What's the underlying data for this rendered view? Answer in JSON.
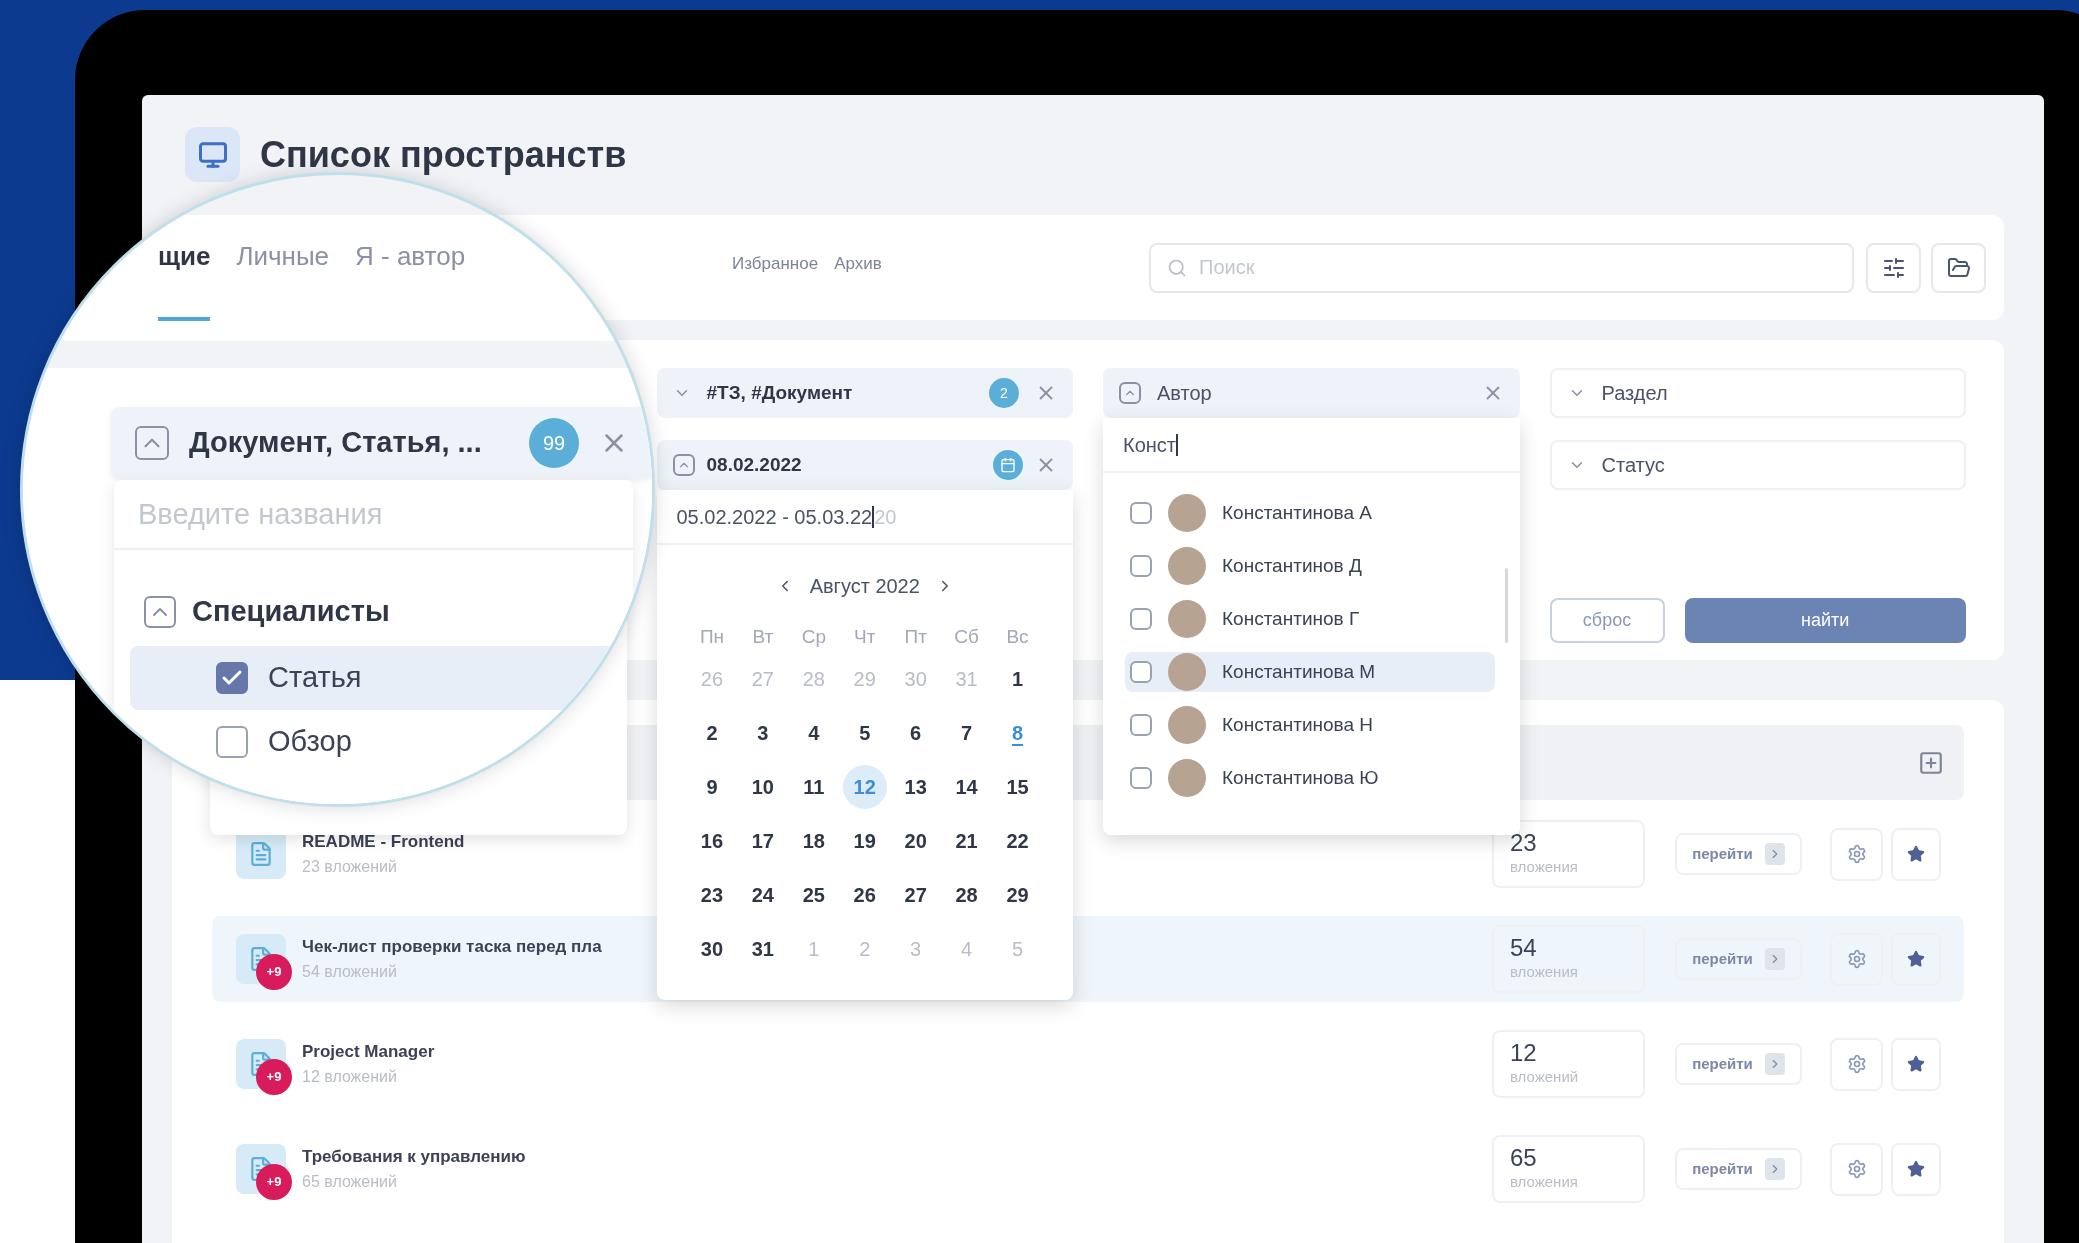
{
  "page_title": "Список пространств",
  "magnifier": {
    "tabs": [
      {
        "label": "щие",
        "selected": true
      },
      {
        "label": "Личные",
        "selected": false
      },
      {
        "label": "Я - автор",
        "selected": false
      }
    ],
    "doc_filter": {
      "value": "Документ, Статья, ...",
      "count": "99",
      "placeholder": "Введите названия",
      "group": {
        "label": "Специалисты",
        "expanded": true,
        "items": [
          {
            "label": "Статья",
            "checked": true
          },
          {
            "label": "Обзор",
            "checked": false
          }
        ]
      }
    }
  },
  "tabs": [
    {
      "label": "Избранное",
      "selected": false
    },
    {
      "label": "Архив",
      "selected": false
    }
  ],
  "search": {
    "placeholder": "Поиск"
  },
  "tag_filter": {
    "value": "#ТЗ, #Документ",
    "count": "2",
    "expanded": false
  },
  "date_filter": {
    "value": "08.02.2022",
    "range": "05.02.2022 - 05.03.22",
    "range_hint": "20",
    "month": "Август 2022",
    "weekdays": [
      "Пн",
      "Вт",
      "Ср",
      "Чт",
      "Пт",
      "Сб",
      "Вс"
    ],
    "days": [
      {
        "label": "26",
        "kind": "other"
      },
      {
        "label": "27",
        "kind": "other"
      },
      {
        "label": "28",
        "kind": "other"
      },
      {
        "label": "29",
        "kind": "other"
      },
      {
        "label": "30",
        "kind": "other"
      },
      {
        "label": "31",
        "kind": "other"
      },
      {
        "label": "1",
        "kind": "day"
      },
      {
        "label": "2",
        "kind": "day"
      },
      {
        "label": "3",
        "kind": "day"
      },
      {
        "label": "4",
        "kind": "day"
      },
      {
        "label": "5",
        "kind": "day"
      },
      {
        "label": "6",
        "kind": "day"
      },
      {
        "label": "7",
        "kind": "day"
      },
      {
        "label": "8",
        "kind": "today"
      },
      {
        "label": "9",
        "kind": "day"
      },
      {
        "label": "10",
        "kind": "day"
      },
      {
        "label": "11",
        "kind": "day"
      },
      {
        "label": "12",
        "kind": "selected"
      },
      {
        "label": "13",
        "kind": "day"
      },
      {
        "label": "14",
        "kind": "day"
      },
      {
        "label": "15",
        "kind": "day"
      },
      {
        "label": "16",
        "kind": "day"
      },
      {
        "label": "17",
        "kind": "day"
      },
      {
        "label": "18",
        "kind": "day"
      },
      {
        "label": "19",
        "kind": "day"
      },
      {
        "label": "20",
        "kind": "day"
      },
      {
        "label": "21",
        "kind": "day"
      },
      {
        "label": "22",
        "kind": "day"
      },
      {
        "label": "23",
        "kind": "day"
      },
      {
        "label": "24",
        "kind": "day"
      },
      {
        "label": "25",
        "kind": "day"
      },
      {
        "label": "26",
        "kind": "day"
      },
      {
        "label": "27",
        "kind": "day"
      },
      {
        "label": "28",
        "kind": "day"
      },
      {
        "label": "29",
        "kind": "day"
      },
      {
        "label": "30",
        "kind": "day"
      },
      {
        "label": "31",
        "kind": "day"
      },
      {
        "label": "1",
        "kind": "other"
      },
      {
        "label": "2",
        "kind": "other"
      },
      {
        "label": "3",
        "kind": "other"
      },
      {
        "label": "4",
        "kind": "other"
      },
      {
        "label": "5",
        "kind": "other"
      }
    ]
  },
  "author_filter": {
    "label": "Автор",
    "query": "Конст",
    "people": [
      {
        "name": "Константинова А",
        "checked": false,
        "highlighted": false
      },
      {
        "name": "Константинов Д",
        "checked": false,
        "highlighted": false
      },
      {
        "name": "Константинов Г",
        "checked": false,
        "highlighted": false
      },
      {
        "name": "Константинова М",
        "checked": false,
        "highlighted": true
      },
      {
        "name": "Константинова Н",
        "checked": false,
        "highlighted": false
      },
      {
        "name": "Константинова Ю",
        "checked": false,
        "highlighted": false
      }
    ]
  },
  "section_filter": {
    "placeholder": "Раздел"
  },
  "status_filter": {
    "placeholder": "Статус"
  },
  "buttons": {
    "reset": "сброс",
    "find": "найти"
  },
  "rows": [
    {
      "title": "README - Frontend",
      "subtitle": "23 вложений",
      "count": "23",
      "count_label": "вложения",
      "go": "перейти",
      "highlighted": false
    },
    {
      "title": "Чек-лист проверки таска перед пла",
      "subtitle": "54 вложений",
      "count": "54",
      "count_label": "вложения",
      "go": "перейти",
      "extra": "+9",
      "highlighted": true
    },
    {
      "title": "Project Manager",
      "subtitle": "12 вложений",
      "count": "12",
      "count_label": "вложений",
      "go": "перейти",
      "extra": "+9",
      "highlighted": false
    },
    {
      "title": "Требования к управлению",
      "subtitle": "65 вложений",
      "count": "65",
      "count_label": "вложения",
      "go": "перейти",
      "extra": "+9",
      "highlighted": false
    }
  ]
}
